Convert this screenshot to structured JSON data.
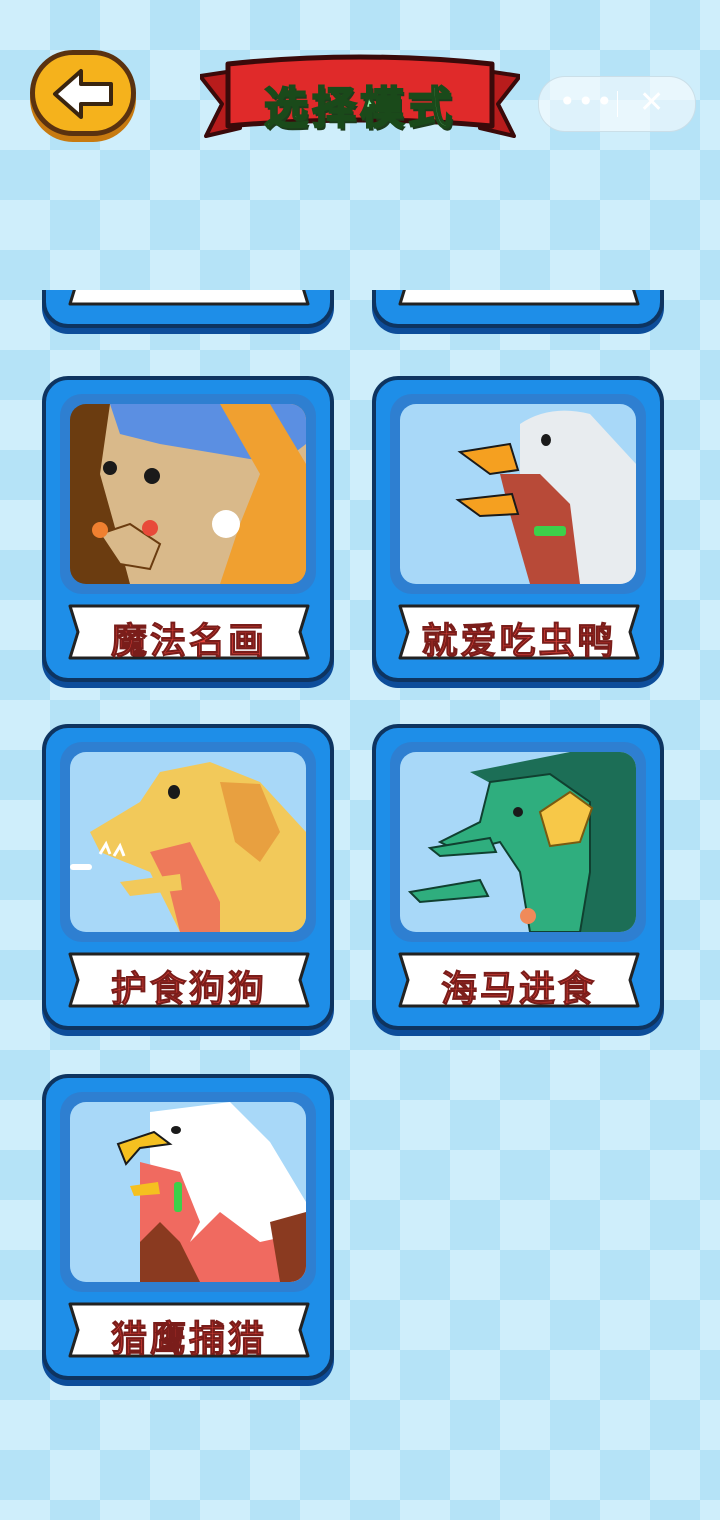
{
  "header": {
    "back_icon": "back-arrow-icon",
    "title": "选择模式",
    "menu_icon": "more-dots-icon",
    "close_icon": "close-icon"
  },
  "modes": [
    {
      "label": "魔法名画",
      "icon": "girl-with-pearl-earring-painting"
    },
    {
      "label": "就爱吃虫鸭",
      "icon": "duck-eating-bug"
    },
    {
      "label": "护食狗狗",
      "icon": "dog-with-bone"
    },
    {
      "label": "海马进食",
      "icon": "seahorse-eating-shrimp"
    },
    {
      "label": "猎鹰捕猎",
      "icon": "eagle-hunting"
    }
  ],
  "colors": {
    "card_blue": "#1e8ee8",
    "label_red": "#e8453c",
    "title_green": "#8ff0a8",
    "banner_red": "#e02a2a",
    "back_orange": "#f5b21c"
  }
}
